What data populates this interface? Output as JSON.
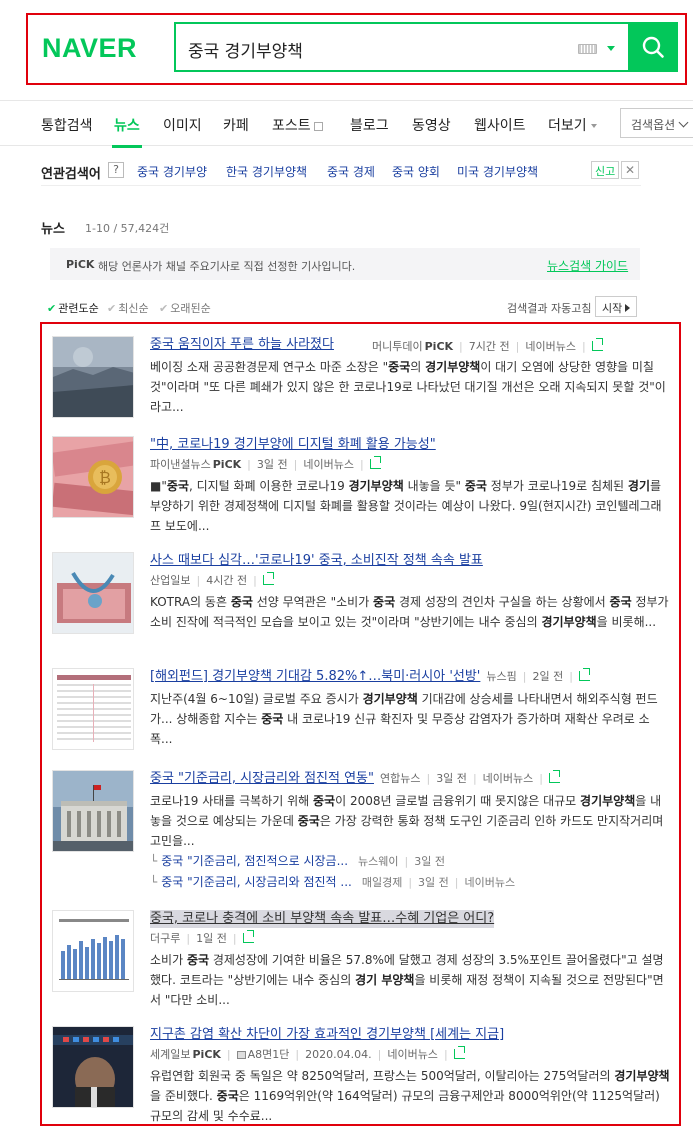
{
  "header": {
    "logo": "NAVER",
    "query": "중국 경기부양책"
  },
  "tabs": {
    "items": [
      "통합검색",
      "뉴스",
      "이미지",
      "카페",
      "포스트",
      "블로그",
      "동영상",
      "웹사이트",
      "더보기"
    ],
    "options_label": "검색옵션"
  },
  "related": {
    "title": "연관검색어",
    "help": "?",
    "items": [
      "중국 경기부양",
      "한국 경기부양책",
      "중국 경제",
      "중국 양회",
      "미국 경기부양책"
    ],
    "report": "신고",
    "close": "✕"
  },
  "section": {
    "title": "뉴스",
    "count": "1-10 / 57,424건",
    "pick_badge": "PiCK",
    "pick_desc": "해당 언론사가 채널 주요기사로 직접 선정한 기사입니다.",
    "guide": "뉴스검색 가이드",
    "sort": [
      "관련도순",
      "최신순",
      "오래된순"
    ],
    "auto_label": "검색결과 자동고침",
    "start": "시작"
  },
  "news": [
    {
      "title": "중국 움직이자 푸른 하늘 사라졌다",
      "source": "머니투데이",
      "pick": "PiCK",
      "time": "7시간 전",
      "portal": "네이버뉴스",
      "desc_html": "베이징 소재 공공환경문제 연구소 마준 소장은 \"<b>중국</b>의 <b>경기부양책</b>이 대기 오염에 상당한 영향을 미칠 것\"이라며 \"또 다른 폐쇄가 있지 않은 한 코로나19로 나타났던 대기질 개선은 오래 지속되지 못할 것\"이라고..."
    },
    {
      "title": "\"中, 코로나19 경기부양에 디지털 화폐 활용 가능성\"",
      "source": "파이낸셜뉴스",
      "pick": "PiCK",
      "time": "3일 전",
      "portal": "네이버뉴스",
      "desc_html": "■\"<b>중국</b>, 디지털 화폐 이용한 코로나19 <b>경기부양책</b> 내놓을 듯\" <b>중국</b> 정부가 코로나19로 침체된 <b>경기</b>를 부양하기 위한 경제정책에 디지털 화폐를 활용할 것이라는 예상이 나왔다. 9일(현지시간) 코인텔레그래프 보도에..."
    },
    {
      "title": "사스 때보다 심각…'코로나19' 중국, 소비진작 정책 속속 발표",
      "source": "산업일보",
      "time": "4시간 전",
      "desc_html": "KOTRA의 동흔 <b>중국</b> 선양 무역관은 \"소비가 <b>중국</b> 경제 성장의 견인차 구실을 하는 상황에서 <b>중국</b> 정부가 소비 진작에 적극적인 모습을 보이고 있는 것\"이라며 \"상반기에는 내수 중심의 <b>경기부양책</b>을 비롯해..."
    },
    {
      "title": "[해외펀드] 경기부양책 기대감 5.82%↑…북미·러시아 '선방'",
      "source": "뉴스핌",
      "time": "2일 전",
      "desc_html": "지난주(4월 6~10일) 글로벌 주요 증시가 <b>경기부양책</b> 기대감에 상승세를 나타내면서 해외주식형 펀드가... 상해종합 지수는 <b>중국</b> 내 코로나19 신규 확진자 및 무증상 감염자가 증가하며 재확산 우려로 소폭..."
    },
    {
      "title": "중국 \"기준금리, 시장금리와 점진적 연동\"",
      "source": "연합뉴스",
      "time": "3일 전",
      "portal": "네이버뉴스",
      "desc_html": "코로나19 사태를 극복하기 위해 <b>중국</b>이 2008년 글로벌 금융위기 때 못지않은 대규모 <b>경기부양책</b>을 내놓을 것으로 예상되는 가운데 <b>중국</b>은 가장 강력한 통화 정책 도구인 기준금리 인하 카드도 만지작거리며 고민을...",
      "subs": [
        {
          "title": "중국 \"기준금리, 점진적으로 시장금...",
          "source": "뉴스웨이",
          "time": "3일 전"
        },
        {
          "title": "중국 \"기준금리, 시장금리와 점진적 ...",
          "source": "매일경제",
          "time": "3일 전",
          "portal": "네이버뉴스"
        }
      ]
    },
    {
      "title": "중국, 코로나 충격에 소비 부양책 속속 발표…수혜 기업은 어디?",
      "source": "더구루",
      "time": "1일 전",
      "desc_html": "소비가 <b>중국</b> 경제성장에 기여한 비율은 57.8%에 달했고 경제 성장의 3.5%포인트 끌어올렸다\"고 설명했다. 코트라는 \"상반기에는 내수 중심의 <b>경기 부양책</b>을 비롯해 재정 정책이 지속될 것으로 전망된다\"면서 \"다만 소비..."
    },
    {
      "title": "지구촌 감염 확산 차단이 가장 효과적인 경기부양책 [세계는 지금]",
      "source": "세계일보",
      "pick": "PiCK",
      "paper": "A8면1단",
      "time": "2020.04.04.",
      "portal": "네이버뉴스",
      "desc_html": "유럽연합 회원국 중 독일은 약 8250억달러, 프랑스는 500억달러, 이탈리아는 275억달러의 <b>경기부양책</b>을 준비했다. <b>중국</b>은 1169억위안(약 164억달러) 규모의 금융구제안과 8000억위안(약 1125억달러) 규모의 감세 및 수수료..."
    }
  ]
}
